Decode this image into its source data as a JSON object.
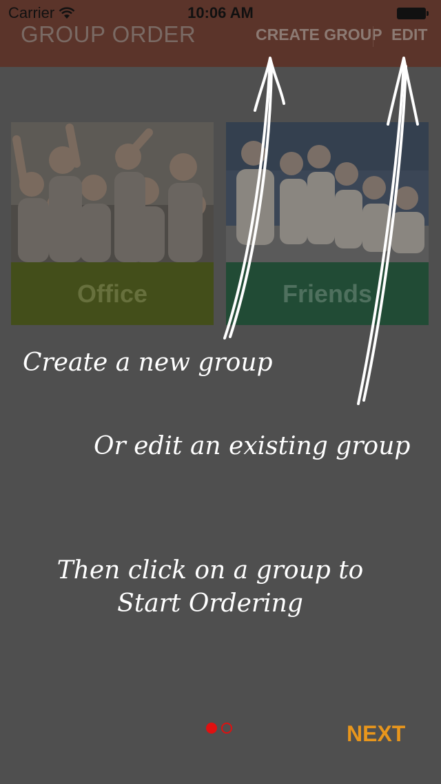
{
  "status_bar": {
    "carrier": "Carrier",
    "time": "10:06 AM"
  },
  "nav": {
    "title": "GROUP ORDER",
    "create_label": "CREATE GROUP",
    "edit_label": "EDIT"
  },
  "groups": [
    {
      "name": "Office"
    },
    {
      "name": "Friends"
    }
  ],
  "tutorial": {
    "line_create": "Create a new group",
    "line_edit": "Or edit an existing group",
    "line_then_1": "Then click on a group to",
    "line_then_2": "Start Ordering"
  },
  "pager": {
    "pages": 2,
    "current": 1
  },
  "next_label": "NEXT",
  "colors": {
    "accent": "#e8961c",
    "pager": "#e01010",
    "header": "#5b342a"
  }
}
